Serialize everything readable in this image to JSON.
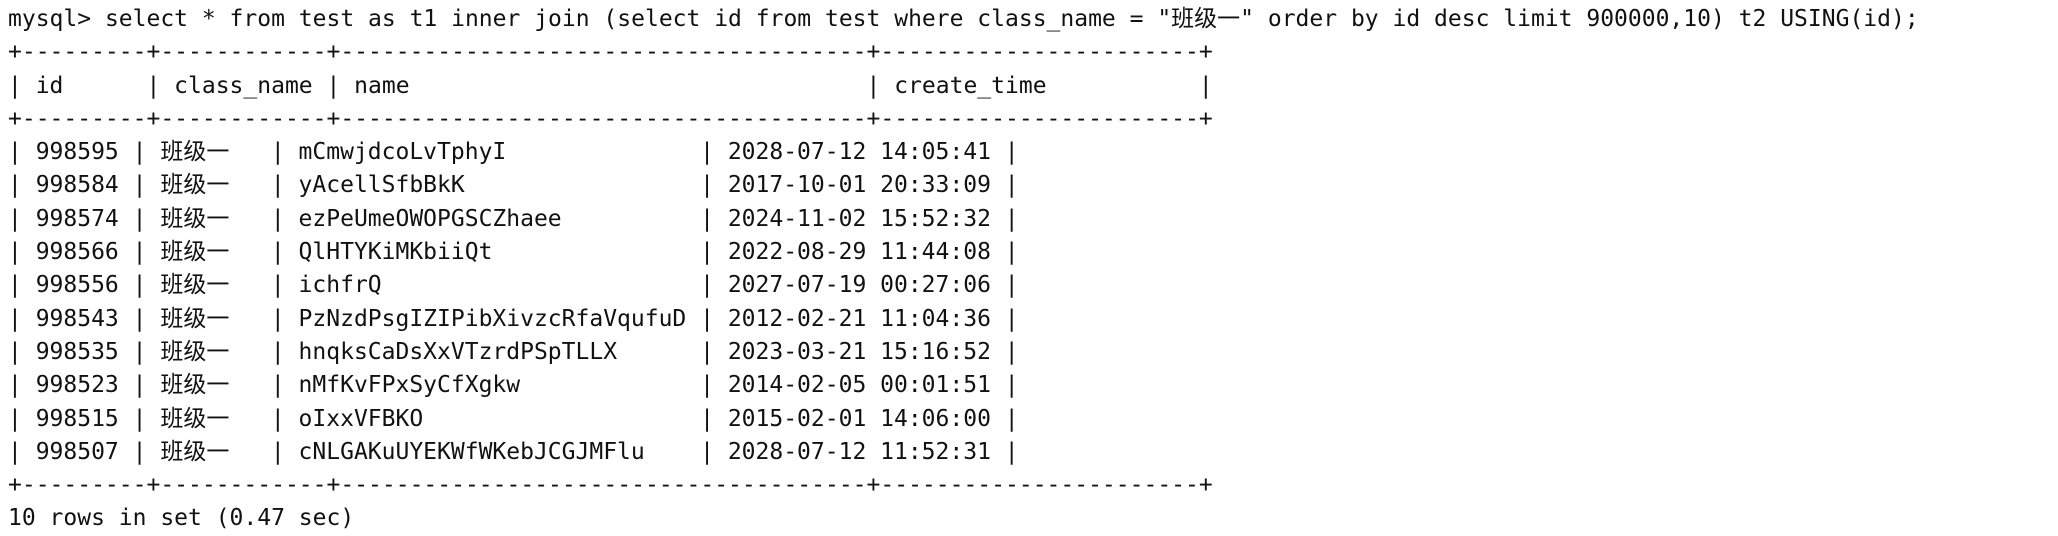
{
  "terminal": {
    "prompt": "mysql> ",
    "command": "select * from test as t1 inner join (select id from test where class_name = \"班级一\" order by id desc limit 900000,10) t2 USING(id);"
  },
  "table": {
    "columns": [
      "id",
      "class_name",
      "name",
      "create_time"
    ],
    "rows": [
      [
        "998595",
        "班级一",
        "mCmwjdcoLvTphyI",
        "2028-07-12 14:05:41"
      ],
      [
        "998584",
        "班级一",
        "yAcellSfbBkK",
        "2017-10-01 20:33:09"
      ],
      [
        "998574",
        "班级一",
        "ezPeUmeOWOPGSCZhaee",
        "2024-11-02 15:52:32"
      ],
      [
        "998566",
        "班级一",
        "QlHTYKiMKbiiQt",
        "2022-08-29 11:44:08"
      ],
      [
        "998556",
        "班级一",
        "ichfrQ",
        "2027-07-19 00:27:06"
      ],
      [
        "998543",
        "班级一",
        "PzNzdPsgIZIPibXivzcRfaVqufuD",
        "2012-02-21 11:04:36"
      ],
      [
        "998535",
        "班级一",
        "hnqksCaDsXxVTzrdPSpTLLX",
        "2023-03-21 15:16:52"
      ],
      [
        "998523",
        "班级一",
        "nMfKvFPxSyCfXgkw",
        "2014-02-05 00:01:51"
      ],
      [
        "998515",
        "班级一",
        "oIxxVFBKO",
        "2015-02-01 14:06:00"
      ],
      [
        "998507",
        "班级一",
        "cNLGAKuUYEKWfWKebJCGJMFlu",
        "2028-07-12 11:52:31"
      ]
    ],
    "border_top": "+---------+------------+--------------------------------------+-----------------------+",
    "header_line": "| id      | class_name | name                                 | create_time           |",
    "border_mid": "+---------+------------+--------------------------------------+-----------------------+",
    "border_bottom": "+---------+------------+--------------------------------------+-----------------------+"
  },
  "result": {
    "summary": "10 rows in set (0.47 sec)"
  }
}
